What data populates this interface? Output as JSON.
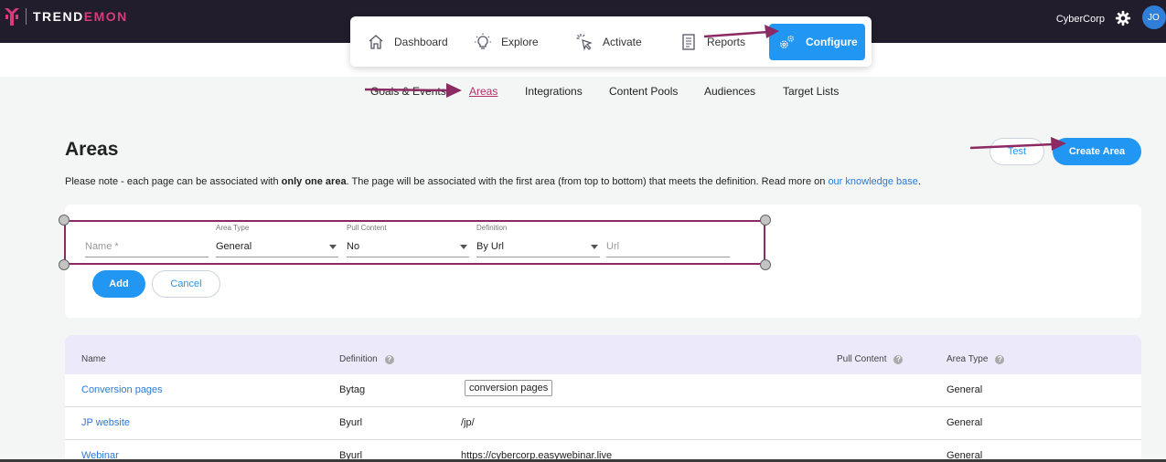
{
  "brand": {
    "name_part1": "TREND",
    "name_part2": "EMON",
    "accent": "#d63b7a"
  },
  "topbar": {
    "org": "CyberCorp",
    "avatar_initials": "JO",
    "settings_icon": "gear-icon"
  },
  "mainnav": {
    "items": [
      {
        "label": "Dashboard",
        "icon": "home-icon"
      },
      {
        "label": "Explore",
        "icon": "lightbulb-icon"
      },
      {
        "label": "Activate",
        "icon": "cursor-click-icon"
      },
      {
        "label": "Reports",
        "icon": "report-icon"
      },
      {
        "label": "Configure",
        "icon": "gears-icon",
        "active": true
      }
    ]
  },
  "subnav": {
    "items": [
      "Goals & Events",
      "Areas",
      "Integrations",
      "Content Pools",
      "Audiences",
      "Target Lists"
    ],
    "active": "Areas"
  },
  "page": {
    "title": "Areas",
    "test_button": "Test",
    "create_button": "Create Area",
    "note_prefix": "Please note - each page can be associated with ",
    "note_bold": "only one area",
    "note_suffix": ". The page will be associated with the first area (from top to bottom) that meets the definition. Read more on ",
    "note_link": "our knowledge base",
    "note_end": "."
  },
  "form": {
    "name_placeholder": "Name *",
    "area_type_label": "Area Type",
    "area_type_value": "General",
    "pull_content_label": "Pull Content",
    "pull_content_value": "No",
    "definition_label": "Definition",
    "definition_value": "By Url",
    "url_placeholder": "Url",
    "add_button": "Add",
    "cancel_button": "Cancel"
  },
  "table": {
    "headers": {
      "name": "Name",
      "definition": "Definition",
      "pull_content": "Pull Content",
      "area_type": "Area Type"
    },
    "help_glyph": "?",
    "rows": [
      {
        "name": "Conversion pages",
        "definition": "Bytag",
        "value": "conversion pages",
        "area_type": "General"
      },
      {
        "name": "JP website",
        "definition": "Byurl",
        "value": "/jp/",
        "area_type": "General"
      },
      {
        "name": "Webinar",
        "definition": "Byurl",
        "value": "https://cybercorp.easywebinar.live",
        "area_type": "General"
      }
    ]
  },
  "colors": {
    "topbar": "#221d2c",
    "primary": "#2196f3",
    "annotation": "#8b2a63",
    "table_header": "#ece9fb",
    "link": "#2a7ad6"
  }
}
